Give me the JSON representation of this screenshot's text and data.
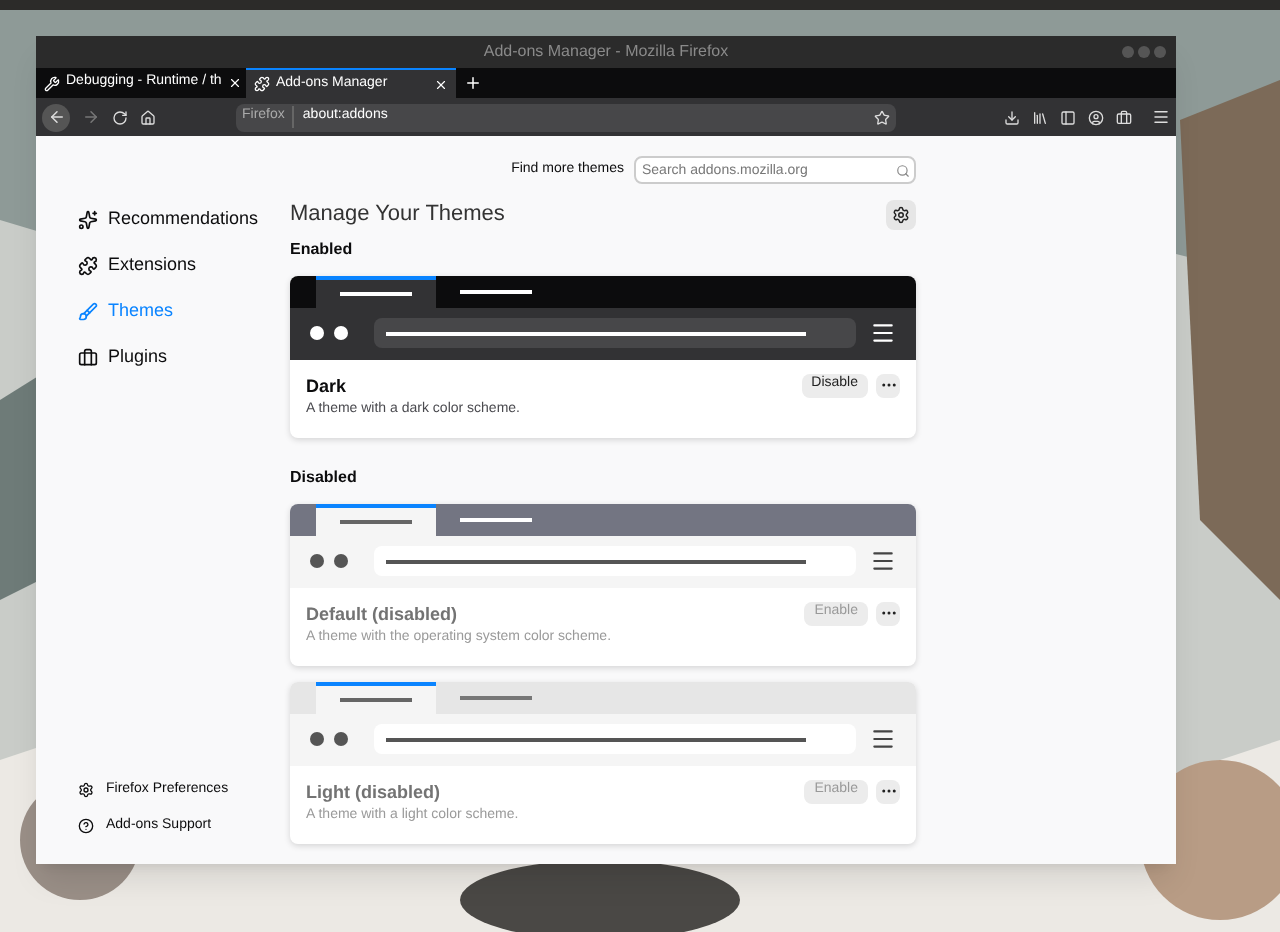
{
  "window": {
    "title": "Add-ons Manager - Mozilla Firefox"
  },
  "tabs": [
    {
      "label": "Debugging - Runtime / th",
      "selected": false
    },
    {
      "label": "Add-ons Manager",
      "selected": true
    }
  ],
  "address_bar": {
    "identity": "Firefox",
    "url": "about:addons"
  },
  "find_more": {
    "label": "Find more themes",
    "placeholder": "Search addons.mozilla.org"
  },
  "sidebar": {
    "items": [
      {
        "label": "Recommendations",
        "selected": false
      },
      {
        "label": "Extensions",
        "selected": false
      },
      {
        "label": "Themes",
        "selected": true
      },
      {
        "label": "Plugins",
        "selected": false
      }
    ],
    "footer": [
      {
        "label": "Firefox Preferences"
      },
      {
        "label": "Add-ons Support"
      }
    ]
  },
  "heading": "Manage Your Themes",
  "sections": [
    {
      "title": "Enabled",
      "themes": [
        {
          "kind": "dark",
          "name": "Dark",
          "description": "A theme with a dark color scheme.",
          "action": "Disable",
          "enabled": true
        }
      ]
    },
    {
      "title": "Disabled",
      "themes": [
        {
          "kind": "default",
          "name": "Default (disabled)",
          "description": "A theme with the operating system color scheme.",
          "action": "Enable",
          "enabled": false
        },
        {
          "kind": "light",
          "name": "Light (disabled)",
          "description": "A theme with a light color scheme.",
          "action": "Enable",
          "enabled": false
        }
      ]
    }
  ]
}
